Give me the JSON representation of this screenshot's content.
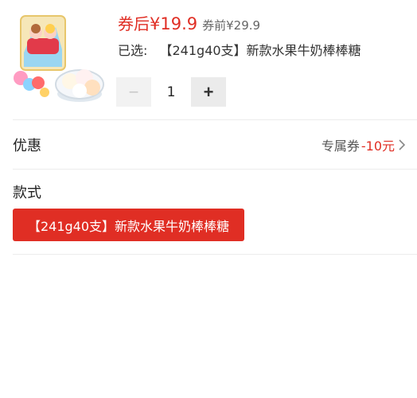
{
  "product": {
    "thumbnail_icon": "candy-product-image",
    "price_after_label": "券后",
    "price_after_value": "¥19.9",
    "price_before_label": "券前",
    "price_before_value": "¥29.9",
    "selected_label": "已选:",
    "selected_value": "【241g40支】新款水果牛奶棒棒糖"
  },
  "quantity": {
    "minus_symbol": "−",
    "value": "1",
    "plus_symbol": "+"
  },
  "promo": {
    "title": "优惠",
    "coupon_label": "专属券",
    "coupon_value": "-10元",
    "chevron_icon": "chevron-right-icon"
  },
  "style": {
    "title": "款式",
    "options": [
      "【241g40支】新款水果牛奶棒棒糖"
    ]
  },
  "colors": {
    "accent": "#e02e24",
    "muted": "#666666",
    "divider": "#ececec"
  }
}
